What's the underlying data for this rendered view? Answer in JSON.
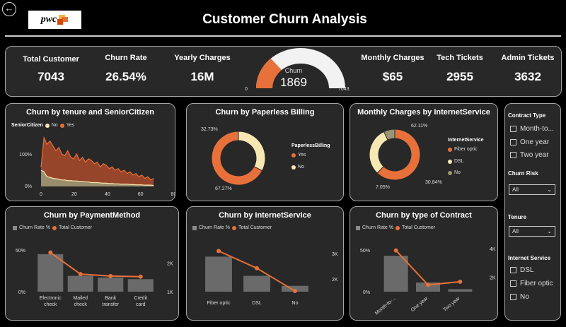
{
  "header": {
    "back_icon": "arrow-left-circle-icon",
    "logo_text": "pwc",
    "title": "Customer Churn Analysis"
  },
  "colors": {
    "orange": "#e8703a",
    "cream": "#f7e8b3",
    "olive": "#9a9572",
    "grey": "#6a6a6a",
    "panel": "#282828"
  },
  "kpis": {
    "total_customer": {
      "label": "Total Customer",
      "value": "7043"
    },
    "churn_rate": {
      "label": "Churn Rate",
      "value": "26.54%"
    },
    "yearly_charges": {
      "label": "Yearly Charges",
      "value": "16M"
    },
    "monthly_charges": {
      "label": "Monthly Charges",
      "value": "$65"
    },
    "tech_tickets": {
      "label": "Tech Tickets",
      "value": "2955"
    },
    "admin_tickets": {
      "label": "Admin Tickets",
      "value": "3632"
    }
  },
  "gauge": {
    "label": "Churn",
    "value": "1869",
    "min": "0",
    "max": "7043",
    "fraction": 0.2654
  },
  "filters": {
    "contract_type": {
      "label": "Contract Type",
      "options": [
        "Month-to...",
        "One year",
        "Two year"
      ]
    },
    "churn_risk": {
      "label": "Churn Risk",
      "value": "All"
    },
    "tenure": {
      "label": "Tenure",
      "value": "All"
    },
    "internet_service": {
      "label": "Internet Service",
      "options": [
        "DSL",
        "Fiber optic",
        "No"
      ]
    }
  },
  "chart_data": [
    {
      "id": "tenure",
      "type": "area",
      "title": "Churn by tenure and SeniorCitizen",
      "legend_title": "SeniorCitizen",
      "legend": [
        "No",
        "Yes"
      ],
      "x_ticks": [
        "0",
        "20",
        "40",
        "60",
        "80"
      ],
      "y_ticks": [
        "100%",
        "0%"
      ],
      "xlim": [
        0,
        80
      ],
      "ylim": [
        0,
        150
      ],
      "series": [
        {
          "name": "Yes",
          "values": [
            60,
            150,
            130,
            140,
            125,
            110,
            120,
            100,
            95,
            110,
            90,
            85,
            100,
            80,
            90,
            75,
            85,
            80,
            70,
            75,
            60,
            70,
            65,
            55,
            60,
            50,
            55,
            45,
            50,
            40,
            45,
            35,
            40,
            30,
            35,
            25,
            30,
            20,
            25
          ]
        },
        {
          "name": "No",
          "values": [
            50,
            45,
            30,
            28,
            25,
            24,
            22,
            20,
            20,
            18,
            18,
            17,
            17,
            15,
            15,
            14,
            14,
            12,
            12,
            12,
            11,
            10,
            10,
            9,
            9,
            8,
            8,
            7,
            7,
            7,
            6,
            6,
            5,
            5,
            5,
            4,
            4,
            4,
            3
          ]
        }
      ]
    },
    {
      "id": "paperless",
      "type": "pie",
      "title": "Churn by Paperless Billing",
      "legend_title": "PaperlessBilling",
      "labels": [
        "Yes",
        "No"
      ],
      "values": [
        67.27,
        32.73
      ],
      "value_labels": [
        "67.27%",
        "32.73%"
      ]
    },
    {
      "id": "monthly",
      "type": "pie",
      "title": "Monthly Charges by InternetService",
      "legend_title": "InternetService",
      "labels": [
        "Fiber optic",
        "DSL",
        "No"
      ],
      "values": [
        62.11,
        30.84,
        7.05
      ],
      "value_labels": [
        "62.11%",
        "30.84%",
        "7.05%"
      ]
    },
    {
      "id": "payment",
      "type": "bar",
      "title": "Churn by PaymentMethod",
      "legend": [
        "Churn Rate %",
        "Total Customer"
      ],
      "categories": [
        "Electronic check",
        "Mailed check",
        "Bank transfer",
        "Credit card"
      ],
      "bar_values": [
        45,
        19,
        17,
        15
      ],
      "line_values": [
        2365,
        1612,
        1544,
        1522
      ],
      "left_ticks": [
        "50%",
        "0%"
      ],
      "right_ticks": [
        "2K",
        "1K"
      ],
      "ylim_left": [
        0,
        55
      ],
      "ylim_right": [
        1000,
        2600
      ]
    },
    {
      "id": "internet",
      "type": "bar",
      "title": "Churn by InternetService",
      "legend": [
        "Churn Rate %",
        "Total Customer"
      ],
      "categories": [
        "Fiber optic",
        "DSL",
        "No"
      ],
      "bar_values": [
        42,
        19,
        7
      ],
      "line_values": [
        3096,
        2421,
        1526
      ],
      "left_ticks": [],
      "right_ticks": [
        "3K",
        "2K"
      ],
      "ylim_left": [
        0,
        55
      ],
      "ylim_right": [
        1500,
        3300
      ]
    },
    {
      "id": "contract",
      "type": "bar",
      "title": "Churn by type of Contract",
      "legend": [
        "Churn Rate %",
        "Total Customer"
      ],
      "categories": [
        "Month-to-...",
        "One year",
        "Two year"
      ],
      "bar_values": [
        43,
        11,
        3
      ],
      "line_values": [
        3875,
        1473,
        1695
      ],
      "left_ticks": [
        "50%",
        "0%"
      ],
      "right_ticks": [
        "4K",
        "2K"
      ],
      "ylim_left": [
        0,
        55
      ],
      "ylim_right": [
        1000,
        4200
      ]
    }
  ]
}
